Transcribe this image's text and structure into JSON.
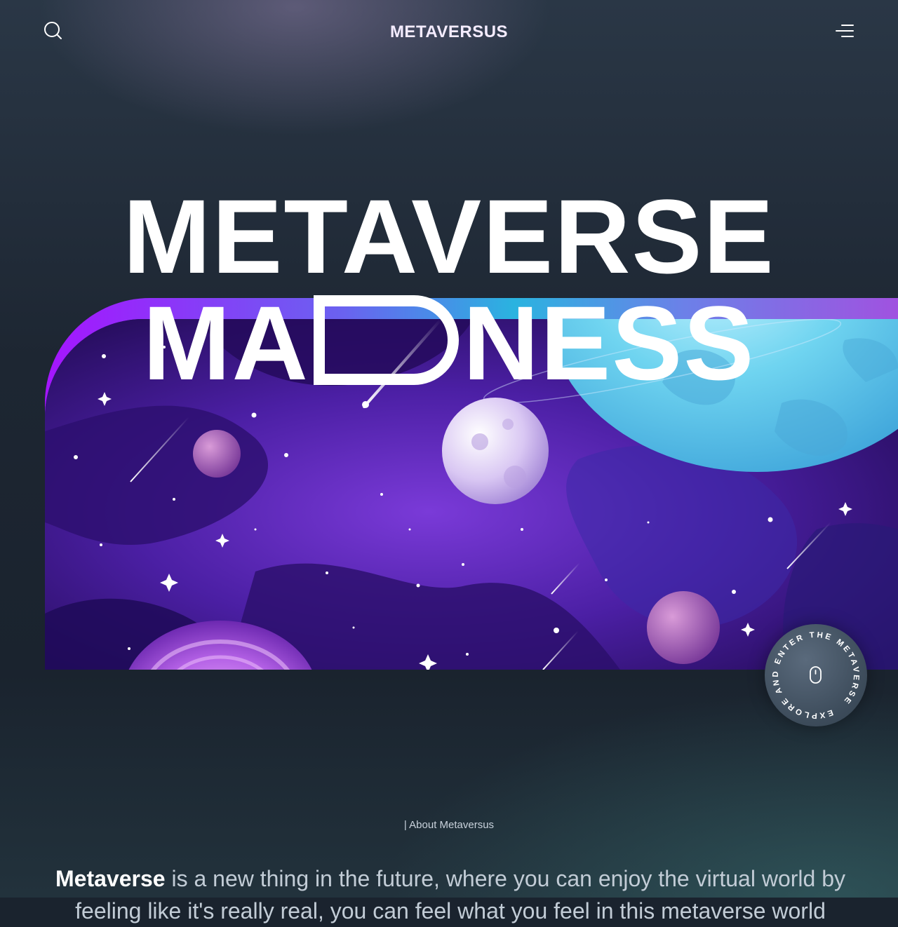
{
  "nav": {
    "logo": "METAVERSUS",
    "search_icon": "search-icon",
    "menu_icon": "menu-icon"
  },
  "hero": {
    "title_line1": "METAVERSE",
    "title_line2_left": "MA",
    "title_line2_right": "NESS"
  },
  "explore": {
    "circular_text": "EXPLORE AND ENTER THE METAVERSE",
    "icon": "mouse-icon"
  },
  "about": {
    "label": "| About Metaversus",
    "highlight": "Metaverse",
    "text": " is a new thing in the future, where you can enjoy the virtual world by feeling like it's really real, you can feel what you feel in this metaverse world"
  },
  "colors": {
    "background": "#1a232e",
    "gradient_start": "#a515ff",
    "gradient_mid": "#2ab3e0",
    "gradient_end": "#a052e0"
  }
}
